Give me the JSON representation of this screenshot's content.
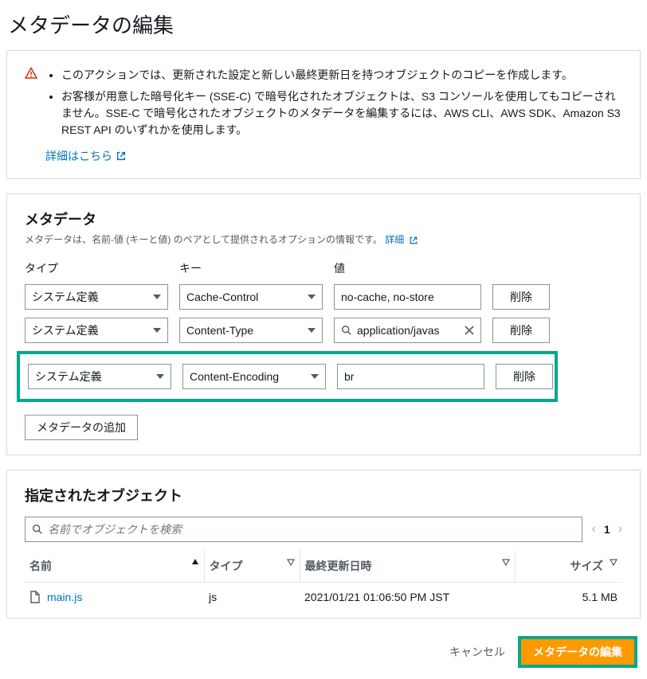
{
  "page_title": "メタデータの編集",
  "alert": {
    "items": [
      "このアクションでは、更新された設定と新しい最終更新日を持つオブジェクトのコピーを作成します。",
      "お客様が用意した暗号化キー (SSE-C) で暗号化されたオブジェクトは、S3 コンソールを使用してもコピーされません。SSE-C で暗号化されたオブジェクトのメタデータを編集するには、AWS CLI、AWS SDK、Amazon S3 REST API のいずれかを使用します。"
    ],
    "learn_more": "詳細はこちら"
  },
  "metadata": {
    "heading": "メタデータ",
    "desc_prefix": "メタデータは、名前-値 (キーと値) のペアとして提供されるオプションの情報です。",
    "desc_link": "詳細",
    "cols": {
      "type": "タイプ",
      "key": "キー",
      "value": "値"
    },
    "rows": [
      {
        "type": "システム定義",
        "key": "Cache-Control",
        "value": "no-cache, no-store",
        "searchable": false
      },
      {
        "type": "システム定義",
        "key": "Content-Type",
        "value": "application/javas",
        "searchable": true
      },
      {
        "type": "システム定義",
        "key": "Content-Encoding",
        "value": "br",
        "searchable": false,
        "highlight": true
      }
    ],
    "remove_label": "削除",
    "add_label": "メタデータの追加"
  },
  "objects": {
    "heading": "指定されたオブジェクト",
    "search_placeholder": "名前でオブジェクトを検索",
    "page": "1",
    "cols": {
      "name": "名前",
      "type": "タイプ",
      "modified": "最終更新日時",
      "size": "サイズ"
    },
    "rows": [
      {
        "name": "main.js",
        "type": "js",
        "modified": "2021/01/21 01:06:50 PM JST",
        "size": "5.1 MB"
      }
    ]
  },
  "footer": {
    "cancel": "キャンセル",
    "submit": "メタデータの編集"
  }
}
